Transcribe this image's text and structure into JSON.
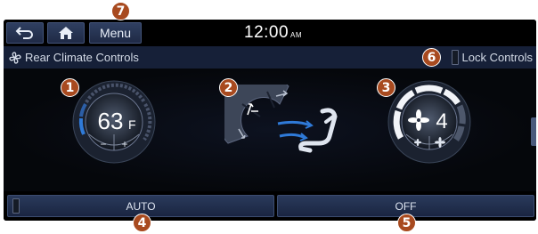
{
  "top_bar": {
    "menu_label": "Menu",
    "clock_time": "12:00",
    "clock_ampm": "AM",
    "back_icon": "back-arrow-icon",
    "home_icon": "home-icon"
  },
  "title_bar": {
    "title": "Rear Climate Controls",
    "title_icon": "fan-icon",
    "lock_label": "Lock Controls"
  },
  "temperature": {
    "value": "63",
    "unit": "F",
    "minus_label": "−",
    "plus_label": "+"
  },
  "fan": {
    "speed": "4"
  },
  "bottom_bar": {
    "auto_label": "AUTO",
    "off_label": "OFF"
  },
  "callouts": [
    "1",
    "2",
    "3",
    "4",
    "5",
    "6",
    "7"
  ],
  "colors": {
    "callout": "#a84a1f",
    "cool_accent": "#2f7ad8",
    "button_bg": "#22304f"
  }
}
